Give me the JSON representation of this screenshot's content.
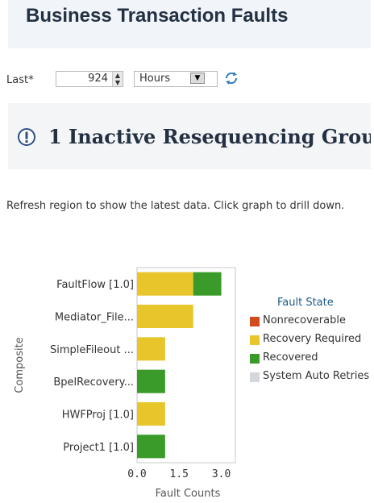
{
  "header": {
    "title": "Business Transaction Faults"
  },
  "filter": {
    "last_label": "Last*",
    "value": "924",
    "units": "Hours"
  },
  "warning": {
    "text": "1 Inactive Resequencing Groups"
  },
  "info": {
    "text": "Refresh region to show the latest data. Click graph to drill down."
  },
  "chart_data": {
    "type": "bar",
    "orientation": "horizontal",
    "stacked": true,
    "categories": [
      "FaultFlow [1.0]",
      "Mediator_File...",
      "SimpleFileout ...",
      "BpelRecovery...",
      "HWFProj [1.0]",
      "Project1 [1.0]"
    ],
    "series": [
      {
        "name": "Nonrecoverable",
        "color": "#d24b1e",
        "values": [
          0,
          0,
          0,
          0,
          0,
          0
        ]
      },
      {
        "name": "Recovery Required",
        "color": "#e8c52a",
        "values": [
          2,
          2,
          1,
          0,
          1,
          0
        ]
      },
      {
        "name": "Recovered",
        "color": "#3a9a2a",
        "values": [
          1,
          0,
          0,
          1,
          0,
          1
        ]
      },
      {
        "name": "System Auto Retries",
        "color": "#d3d6db",
        "values": [
          0,
          0,
          0,
          0,
          0,
          0
        ]
      }
    ],
    "xlabel": "Fault Counts",
    "ylabel": "Composite",
    "xticks": [
      "0.0",
      "1.5",
      "3.0"
    ],
    "xlim": [
      0,
      3.5
    ],
    "legend_title": "Fault State",
    "legend_placement": "right"
  }
}
